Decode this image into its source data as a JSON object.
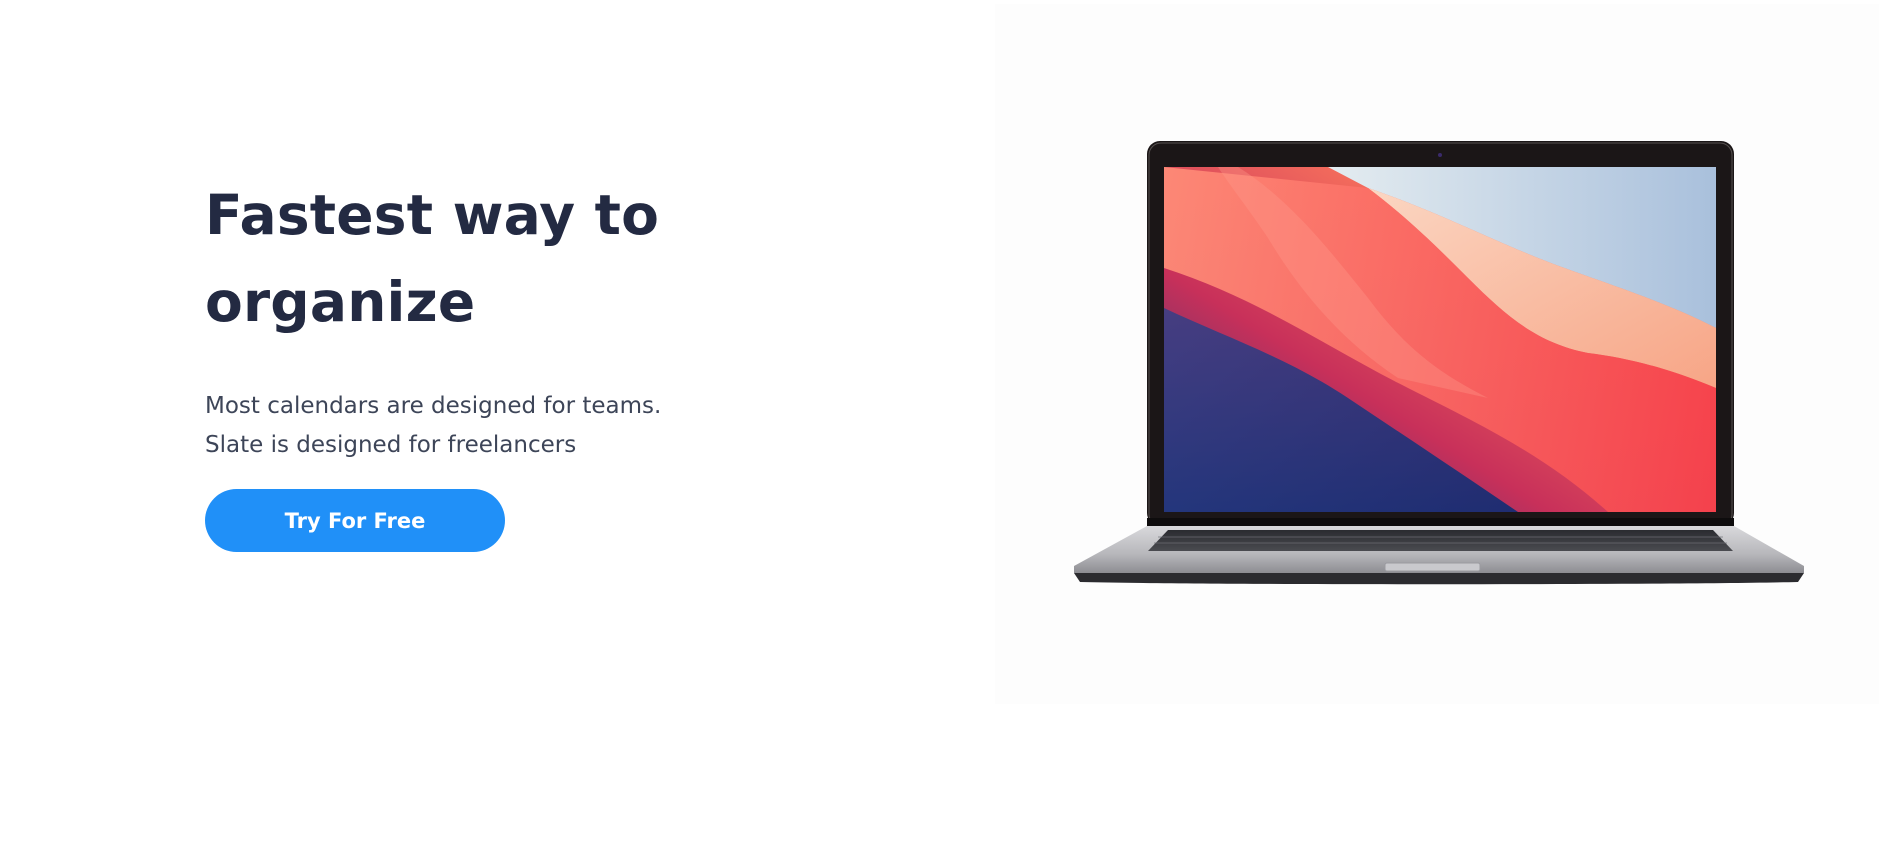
{
  "hero": {
    "title_line1": "Fastest way to",
    "title_line2": "organize",
    "subtitle_line1": "Most calendars are designed for teams.",
    "subtitle_line2": "Slate is designed for freelancers",
    "cta_label": "Try For Free"
  },
  "colors": {
    "heading": "#232a42",
    "body_text": "#3d4558",
    "cta_background": "#2090f8",
    "cta_text": "#ffffff"
  }
}
